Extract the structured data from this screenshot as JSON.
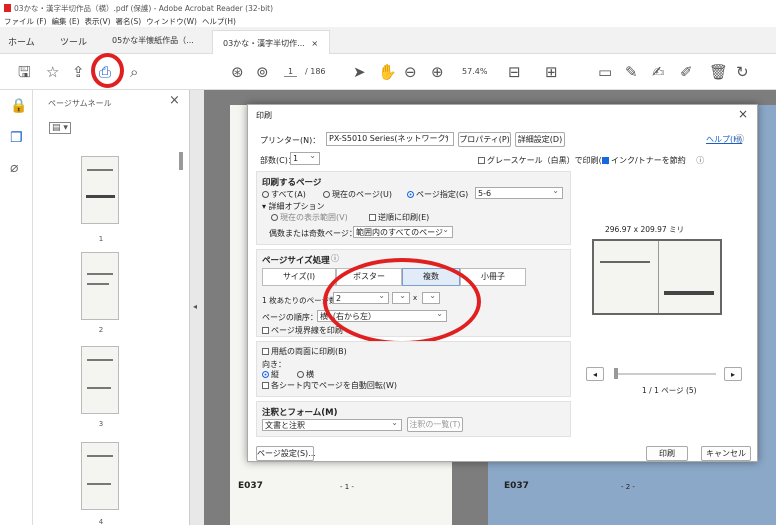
{
  "window": {
    "title": "03かな・漢字半切作品（横）.pdf (保護) - Adobe Acrobat Reader (32-bit)"
  },
  "menu": [
    "ファイル (F)",
    "編集 (E)",
    "表示(V)",
    "署名(S)",
    "ウィンドウ(W)",
    "ヘルプ(H)"
  ],
  "tabs": {
    "home": "ホーム",
    "tools": "ツール",
    "doc1": "05かな半懐紙作品（...",
    "doc2": "03かな・漢字半切作...",
    "close": "×"
  },
  "toolbar": {
    "page_current": "1",
    "page_total": "/ 186",
    "zoom": "57.4%"
  },
  "thumbs": {
    "title": "ページサムネール",
    "close": "×",
    "pages": [
      "1",
      "2",
      "3",
      "4"
    ]
  },
  "doc": {
    "p1_code": "E037",
    "p1_page": "- 1 -",
    "p2_code": "E037",
    "p2_page": "- 2 -"
  },
  "dialog": {
    "title": "印刷",
    "close": "×",
    "printer_label": "プリンター(N)：",
    "printer_value": "PX-S5010 Series(ネットワーク)",
    "properties": "プロパティ(P)",
    "advanced": "詳細設定(D)",
    "help": "ヘルプ(H)",
    "copies_label": "部数(C)：",
    "copies_value": "1",
    "grayscale": "グレースケール（白黒）で印刷(Y)",
    "save_ink": "インク/トナーを節約",
    "range_title": "印刷するページ",
    "all": "すべて(A)",
    "current": "現在のページ(U)",
    "pages": "ページ指定(G)",
    "pages_value": "5-6",
    "more": "▾ 詳細オプション",
    "current_view": "現在の表示範囲(V)",
    "reverse": "逆順に印刷(E)",
    "oddeven_label": "偶数または奇数ページ：",
    "oddeven_value": "範囲内のすべてのページ",
    "sizing_title": "ページサイズ処理",
    "size": "サイズ(I)",
    "poster": "ポスター",
    "multiple": "複数",
    "booklet": "小冊子",
    "pps_label": "1 枚あたりのページ数：",
    "pps_value": "2",
    "pps_x": "x",
    "order_label": "ページの順序：",
    "order_value": "横（右から左）",
    "border": "ページ境界線を印刷",
    "duplex": "用紙の両面に印刷(B)",
    "orient_label": "向き：",
    "portrait": "縦",
    "landscape": "横",
    "autorotate": "各シート内でページを自動回転(W)",
    "comments_title": "注釈とフォーム(M)",
    "comments_value": "文書と注釈",
    "summarize": "注釈の一覧(T)",
    "preview_size": "296.97 x 209.97 ミリ",
    "preview_page": "1 / 1 ページ (5)",
    "page_setup": "ページ設定(S)...",
    "print": "印刷",
    "cancel": "キャンセル"
  },
  "colors": {
    "accent": "#1668e0",
    "highlight": "#e02020"
  }
}
